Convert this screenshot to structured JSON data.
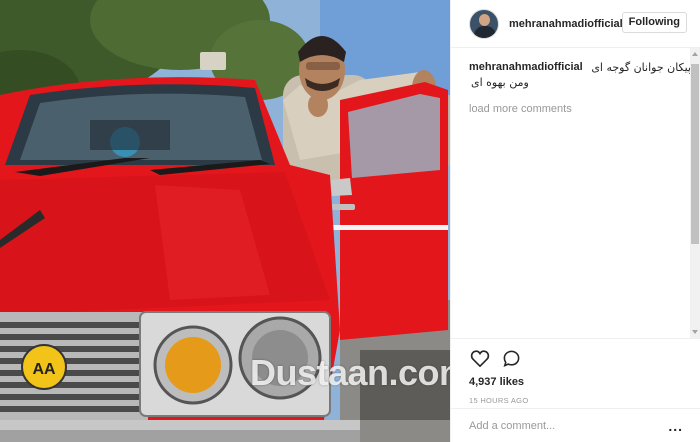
{
  "post": {
    "watermark": "Dustaan.com"
  },
  "header": {
    "username": "mehranahmadiofficial",
    "follow_label": "Following"
  },
  "caption": {
    "username": "mehranahmadiofficial",
    "text_line1": "پیکان جوانان گوجه ای",
    "text_line2": "ومن بهوه ای"
  },
  "comments": {
    "load_more": "load more comments"
  },
  "actions": {
    "likes": "4,937 likes",
    "time": "15 HOURS AGO",
    "like_icon": "heart-icon",
    "comment_icon": "comment-icon"
  },
  "comment_box": {
    "placeholder": "Add a comment...",
    "more_label": "..."
  },
  "colors": {
    "car_red": "#e3161c",
    "sky": "#7fa6cf",
    "panel_border": "#efefef",
    "muted_text": "#999999"
  }
}
